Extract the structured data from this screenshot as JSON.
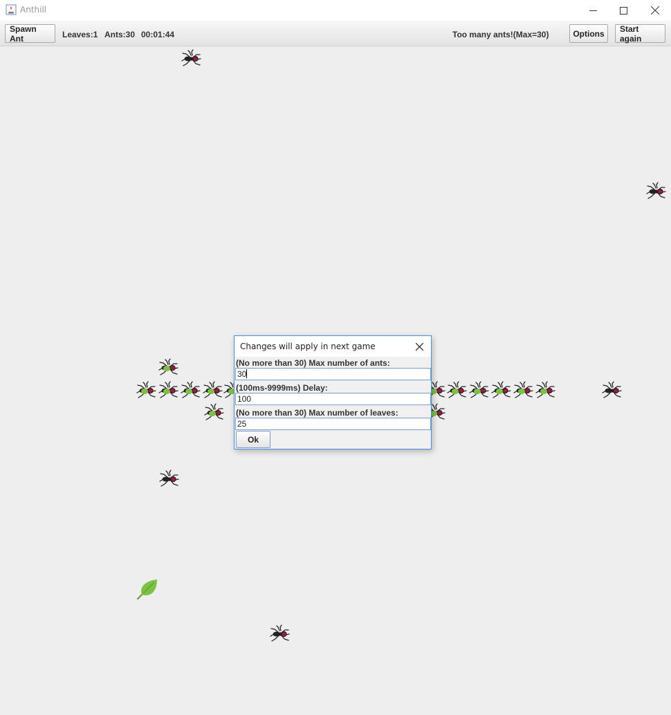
{
  "window": {
    "title": "Anthill"
  },
  "toolbar": {
    "spawn_label": "Spawn Ant",
    "leaves_text": "Leaves:1",
    "ants_text": "Ants:30",
    "timer_text": "00:01:44",
    "status_text": "Too many ants!(Max=30)",
    "options_label": "Options",
    "restart_label": "Start again"
  },
  "dialog": {
    "title": "Changes will apply in next game",
    "fields": [
      {
        "label": "(No more than 30) Max number of ants:",
        "value": "30"
      },
      {
        "label": "(100ms-9999ms) Delay:",
        "value": "100"
      },
      {
        "label": "(No more than 30) Max number of leaves:",
        "value": "25"
      }
    ],
    "ok_label": "Ok"
  },
  "colors": {
    "ant_head": "#b0123f",
    "leaf": "#7cc242",
    "leaf_dark": "#5a9c2e",
    "accent_border": "#4b8fd6"
  }
}
